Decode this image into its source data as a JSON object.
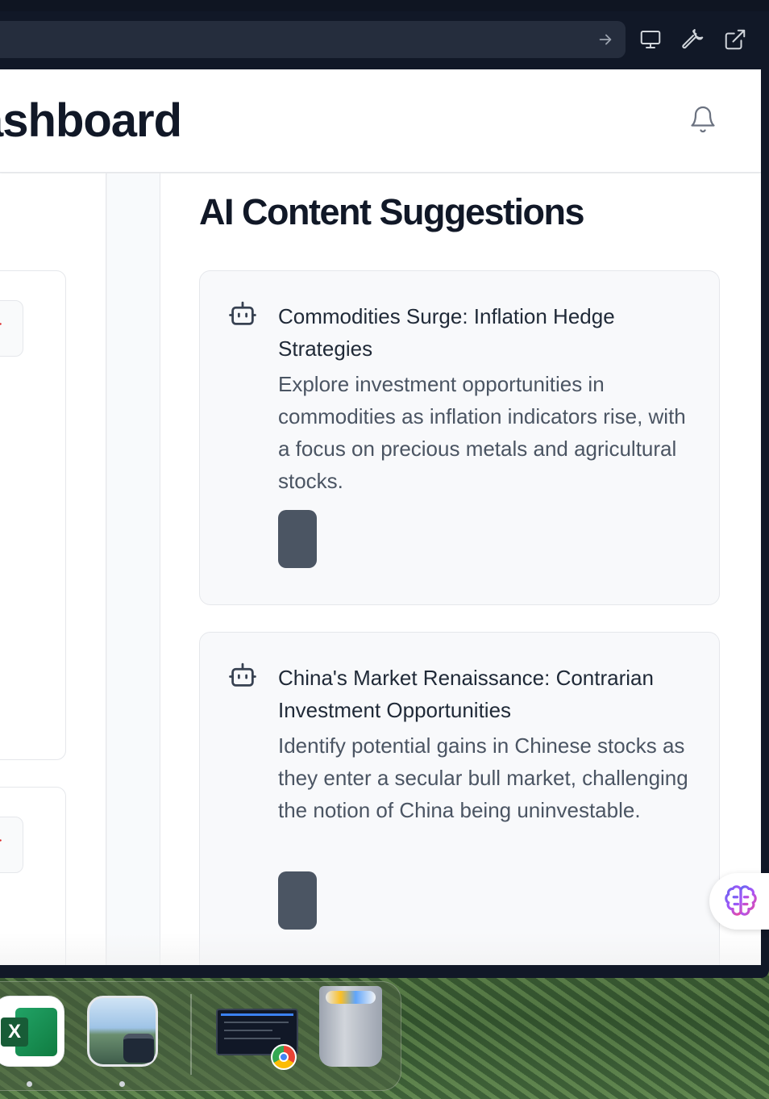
{
  "header": {
    "title": "ashboard"
  },
  "suggestions": {
    "title": "AI Content Suggestions",
    "items": [
      {
        "title": "Commodities Surge: Inflation Hedge Strategies",
        "description": "Explore investment opportunities in commodities as inflation indicators rise, with a focus on precious metals and agricultural stocks."
      },
      {
        "title": "China's Market Renaissance: Contrarian Investment Opportunities",
        "description": "Identify potential gains in Chinese stocks as they enter a secular bull market, challenging the notion of China being uninvestable."
      }
    ]
  },
  "toolbar": {
    "icons": [
      "arrow-right-icon",
      "monitor-icon",
      "wrench-icon",
      "external-link-icon"
    ]
  },
  "dock": {
    "apps": [
      "Microsoft Excel",
      "Preview",
      "Google Chrome",
      "Trash"
    ],
    "excel_letter": "X"
  },
  "colors": {
    "delete": "#dc2626",
    "button": "#4b5563",
    "brain": "#a855f7"
  }
}
